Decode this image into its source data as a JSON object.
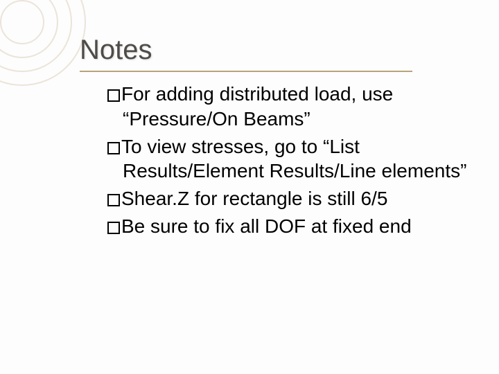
{
  "title": "Notes",
  "bullets": [
    {
      "lead": "For",
      "rest": " adding distributed load, use “Pressure/On Beams”"
    },
    {
      "lead": "To",
      "rest": " view stresses, go to “List Results/Element Results/Line elements”"
    },
    {
      "lead": "Shear.Z",
      "rest": " for rectangle is still 6/5"
    },
    {
      "lead": "Be",
      "rest": " sure to fix all DOF at fixed end"
    }
  ]
}
